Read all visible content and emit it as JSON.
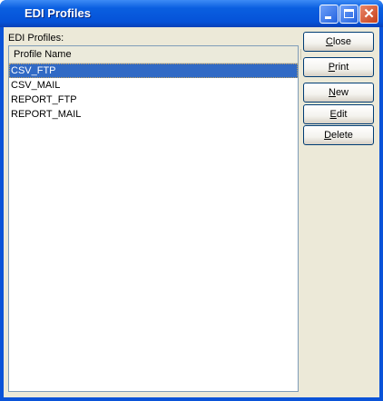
{
  "window": {
    "title": "EDI Profiles"
  },
  "label": "EDI Profiles:",
  "list": {
    "header": "Profile Name",
    "rows": [
      "CSV_FTP",
      "CSV_MAIL",
      "REPORT_FTP",
      "REPORT_MAIL"
    ],
    "selected_index": 0
  },
  "buttons": {
    "close": {
      "key": "C",
      "rest": "lose"
    },
    "print": {
      "key": "P",
      "rest": "rint"
    },
    "new": {
      "key": "N",
      "rest": "ew"
    },
    "edit": {
      "key": "E",
      "rest": "dit"
    },
    "delete": {
      "key": "D",
      "rest": "elete"
    }
  }
}
